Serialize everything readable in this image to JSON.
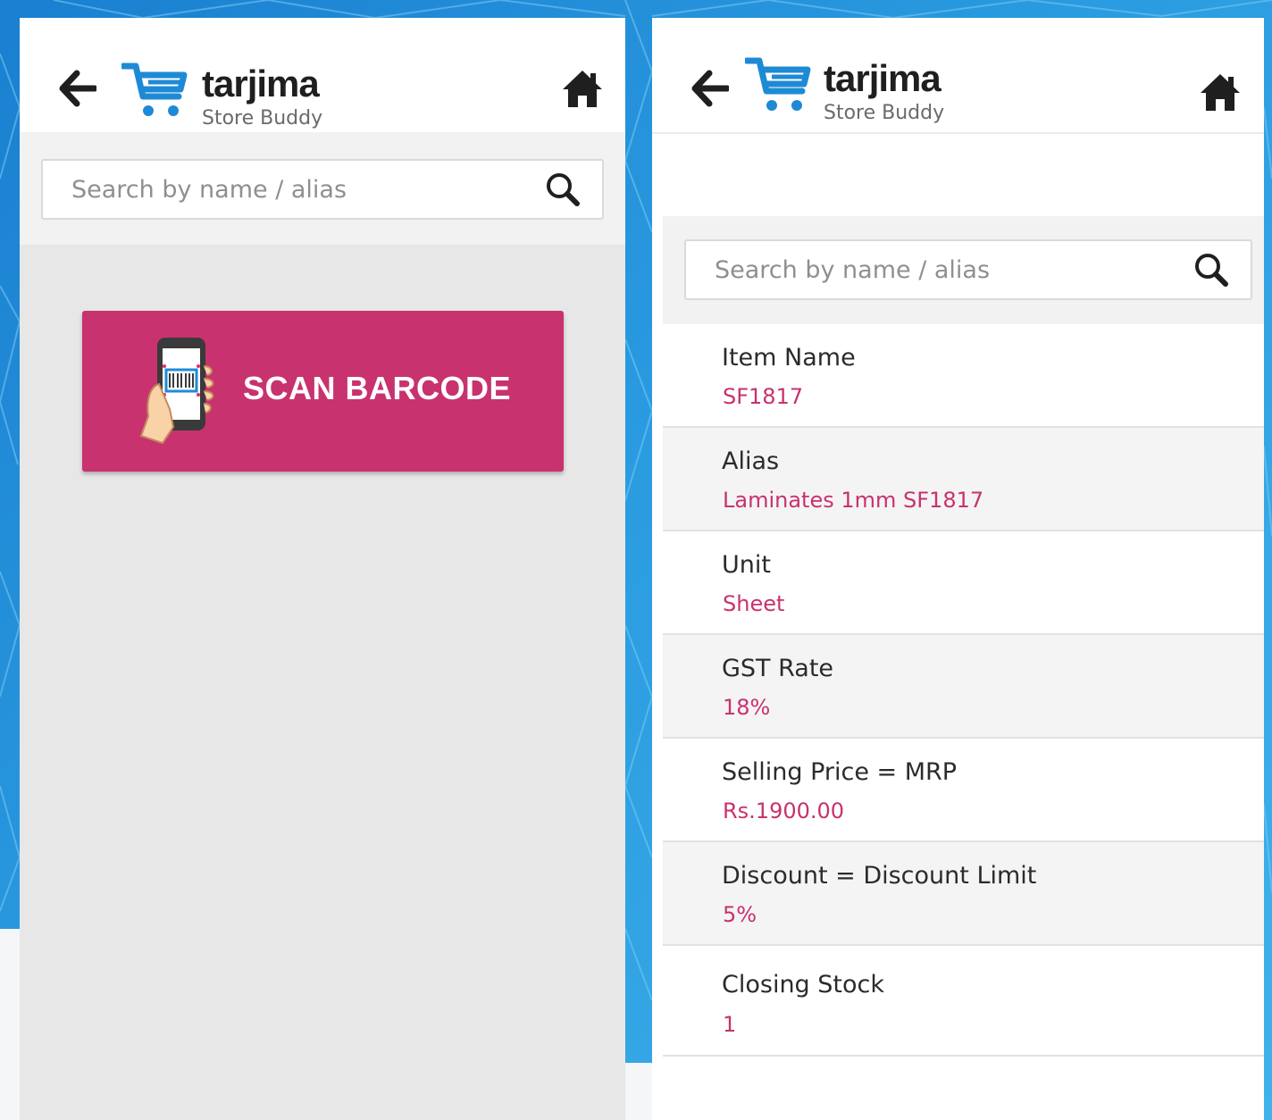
{
  "left_screen": {
    "brand": {
      "name": "tarjima",
      "subtitle": "Store Buddy"
    },
    "search": {
      "placeholder": "Search by name / alias"
    },
    "scan_button": {
      "label": "SCAN BARCODE"
    }
  },
  "right_screen": {
    "brand": {
      "name": "tarjima",
      "subtitle": "Store Buddy"
    },
    "search": {
      "placeholder": "Search by name / alias"
    },
    "details": [
      {
        "label": "Item Name",
        "value": "SF1817"
      },
      {
        "label": "Alias",
        "value": "Laminates 1mm SF1817"
      },
      {
        "label": "Unit",
        "value": "Sheet"
      },
      {
        "label": "GST Rate",
        "value": "18%"
      },
      {
        "label": "Selling Price = MRP",
        "value": "Rs.1900.00"
      },
      {
        "label": "Discount = Discount Limit",
        "value": "5%"
      },
      {
        "label": "Closing Stock",
        "value": "1"
      }
    ]
  },
  "colors": {
    "accent": "#c8326f",
    "brand_blue": "#1e8ad6",
    "icon_dark": "#1f1f1f",
    "background": "#2a9be0"
  },
  "icons": [
    "back-arrow-icon",
    "cart-icon",
    "home-icon",
    "search-icon",
    "phone-barcode-icon"
  ]
}
